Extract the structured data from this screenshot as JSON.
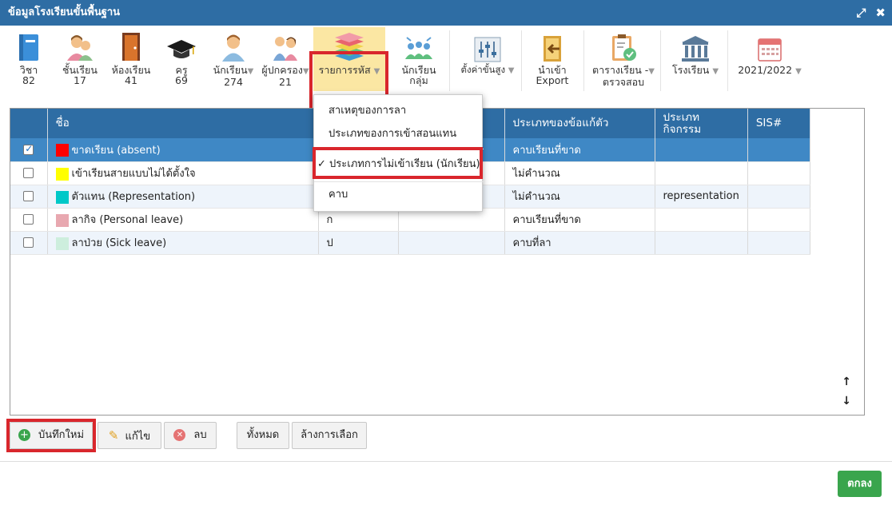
{
  "window": {
    "title": "ข้อมูลโรงเรียนขั้นพื้นฐาน",
    "expand_glyph": "⤢",
    "close_glyph": "✖"
  },
  "toolbar": {
    "subject": {
      "label": "วิชา",
      "count": "82"
    },
    "grade": {
      "label": "ชั้นเรียน",
      "count": "17"
    },
    "classroom": {
      "label": "ห้องเรียน",
      "count": "41"
    },
    "teacher": {
      "label": "ครู",
      "count": "69"
    },
    "student": {
      "label": "นักเรียน",
      "count": "274"
    },
    "parent": {
      "label": "ผู้ปกครอง",
      "count": "21"
    },
    "code_list": {
      "label": "รายการรหัส"
    },
    "student_group": {
      "label1": "นักเรียน",
      "label2": "กลุ่ม"
    },
    "advanced": {
      "label": "ตั้งค่าขั้นสูง"
    },
    "import": {
      "label1": "นำเข้า",
      "label2": "Export"
    },
    "schedule": {
      "label1": "ตารางเรียน -",
      "label2": "ตรวจสอบ"
    },
    "school": {
      "label": "โรงเรียน"
    },
    "year": {
      "label": "2021/2022"
    },
    "dropdown_arrow": "▼"
  },
  "dropdown": {
    "items": [
      "สาเหตุของการลา",
      "ประเภทของการเข้าสอนแทน",
      "ประเภทการไม่เข้าเรียน (นักเรียน)",
      "คาบ"
    ],
    "check": "✓"
  },
  "grid": {
    "headers": [
      "ชื่อ",
      "",
      "",
      "ประเภทของข้อแก้ตัว",
      "ประเภท กิจกรรม",
      "SIS#"
    ],
    "rows": [
      {
        "name": "ขาดเรียน (absent)",
        "color": "#ff0000",
        "code": "",
        "type": "คาบเรียนที่ขาด",
        "activity": "",
        "sis": "",
        "checked": true
      },
      {
        "name": "เข้าเรียนสายแบบไม่ได้ตั้งใจ",
        "color": "#ffff00",
        "code": "",
        "type": "ไม่คำนวณ",
        "activity": "",
        "sis": "",
        "checked": false
      },
      {
        "name": "ตัวแทน (Representation)",
        "color": "#00c8c8",
        "code": "",
        "type": "ไม่คำนวณ",
        "activity": "representation",
        "sis": "",
        "checked": false
      },
      {
        "name": "ลากิจ (Personal leave)",
        "color": "#e8a8b0",
        "code": "ก",
        "type": "คาบเรียนที่ขาด",
        "activity": "",
        "sis": "",
        "checked": false
      },
      {
        "name": "ลาป่วย (Sick leave)",
        "color": "#cdeedd",
        "code": "ป",
        "type": "คาบที่ลา",
        "activity": "",
        "sis": "",
        "checked": false
      }
    ]
  },
  "scroll": {
    "up": "↑",
    "down": "↓"
  },
  "buttons": {
    "new": "บันทึกใหม่",
    "edit": "แก้ไข",
    "delete": "ลบ",
    "all": "ทั้งหมด",
    "clear": "ล้างการเลือก",
    "ok": "ตกลง"
  },
  "colors": {
    "accent": "#2e6da4",
    "selected_row": "#3f88c5",
    "highlight": "#d9262c",
    "ok": "#3aa54d"
  }
}
